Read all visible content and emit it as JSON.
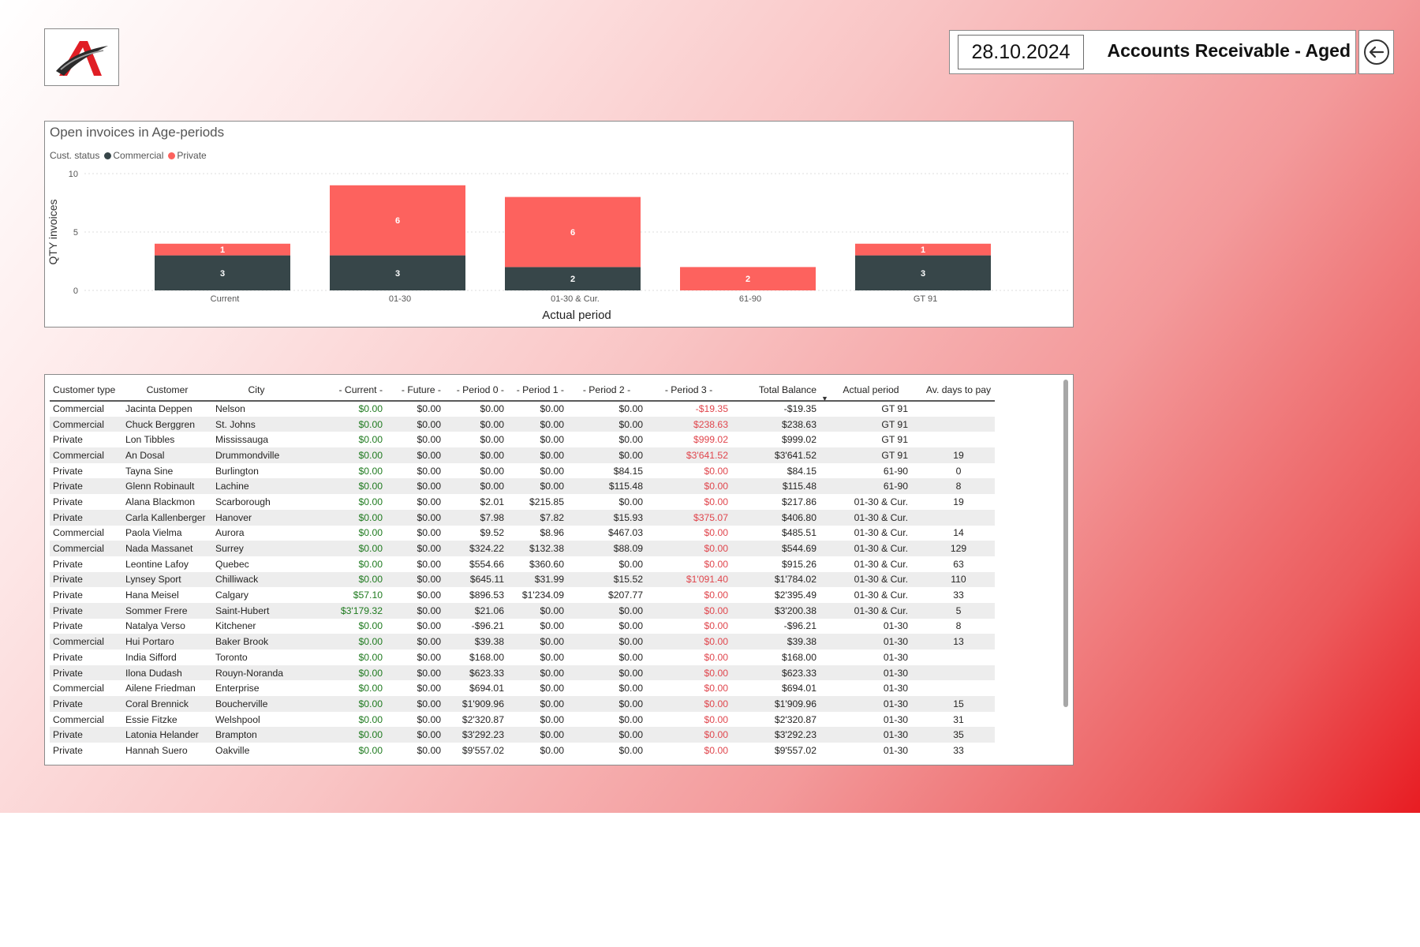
{
  "header": {
    "date": "28.10.2024",
    "title": "Accounts Receivable - Aged",
    "back_icon": "arrow-left-circle-icon"
  },
  "logo": {
    "icon": "company-logo"
  },
  "chart": {
    "title": "Open invoices in Age-periods",
    "legend_label": "Cust. status",
    "legend": [
      {
        "name": "Commercial",
        "color": "#374649"
      },
      {
        "name": "Private",
        "color": "#fd625e"
      }
    ]
  },
  "chart_data": {
    "type": "bar",
    "stacked": true,
    "categories": [
      "Current",
      "01-30",
      "01-30 & Cur.",
      "61-90",
      "GT 91"
    ],
    "series": [
      {
        "name": "Commercial",
        "color": "#374649",
        "values": [
          3,
          3,
          2,
          0,
          3
        ]
      },
      {
        "name": "Private",
        "color": "#fd625e",
        "values": [
          1,
          6,
          6,
          2,
          1
        ]
      }
    ],
    "xlabel": "Actual period",
    "ylabel": "QTY invoices",
    "ylim": [
      0,
      10
    ],
    "yticks": [
      0,
      5,
      10
    ],
    "grid": true,
    "legend_position": "top-left"
  },
  "table": {
    "columns": [
      "Customer type",
      "Customer",
      "City",
      "- Current -",
      "- Future -",
      "- Period 0 -",
      "- Period 1 -",
      "- Period 2 -",
      "- Period 3 -",
      "Total Balance",
      "Actual period",
      "Av. days to pay"
    ],
    "sort_icon": "sort-descending-icon",
    "rows": [
      [
        "Commercial",
        "Jacinta Deppen",
        "Nelson",
        "$0.00",
        "$0.00",
        "$0.00",
        "$0.00",
        "$0.00",
        "-$19.35",
        "-$19.35",
        "GT 91",
        ""
      ],
      [
        "Commercial",
        "Chuck Berggren",
        "St. Johns",
        "$0.00",
        "$0.00",
        "$0.00",
        "$0.00",
        "$0.00",
        "$238.63",
        "$238.63",
        "GT 91",
        ""
      ],
      [
        "Private",
        "Lon Tibbles",
        "Mississauga",
        "$0.00",
        "$0.00",
        "$0.00",
        "$0.00",
        "$0.00",
        "$999.02",
        "$999.02",
        "GT 91",
        ""
      ],
      [
        "Commercial",
        "An Dosal",
        "Drummondville",
        "$0.00",
        "$0.00",
        "$0.00",
        "$0.00",
        "$0.00",
        "$3'641.52",
        "$3'641.52",
        "GT 91",
        "19"
      ],
      [
        "Private",
        "Tayna Sine",
        "Burlington",
        "$0.00",
        "$0.00",
        "$0.00",
        "$0.00",
        "$84.15",
        "$0.00",
        "$84.15",
        "61-90",
        "0"
      ],
      [
        "Private",
        "Glenn Robinault",
        "Lachine",
        "$0.00",
        "$0.00",
        "$0.00",
        "$0.00",
        "$115.48",
        "$0.00",
        "$115.48",
        "61-90",
        "8"
      ],
      [
        "Private",
        "Alana Blackmon",
        "Scarborough",
        "$0.00",
        "$0.00",
        "$2.01",
        "$215.85",
        "$0.00",
        "$0.00",
        "$217.86",
        "01-30 & Cur.",
        "19"
      ],
      [
        "Private",
        "Carla Kallenberger",
        "Hanover",
        "$0.00",
        "$0.00",
        "$7.98",
        "$7.82",
        "$15.93",
        "$375.07",
        "$406.80",
        "01-30 & Cur.",
        ""
      ],
      [
        "Commercial",
        "Paola Vielma",
        "Aurora",
        "$0.00",
        "$0.00",
        "$9.52",
        "$8.96",
        "$467.03",
        "$0.00",
        "$485.51",
        "01-30 & Cur.",
        "14"
      ],
      [
        "Commercial",
        "Nada Massanet",
        "Surrey",
        "$0.00",
        "$0.00",
        "$324.22",
        "$132.38",
        "$88.09",
        "$0.00",
        "$544.69",
        "01-30 & Cur.",
        "129"
      ],
      [
        "Private",
        "Leontine Lafoy",
        "Quebec",
        "$0.00",
        "$0.00",
        "$554.66",
        "$360.60",
        "$0.00",
        "$0.00",
        "$915.26",
        "01-30 & Cur.",
        "63"
      ],
      [
        "Private",
        "Lynsey Sport",
        "Chilliwack",
        "$0.00",
        "$0.00",
        "$645.11",
        "$31.99",
        "$15.52",
        "$1'091.40",
        "$1'784.02",
        "01-30 & Cur.",
        "110"
      ],
      [
        "Private",
        "Hana Meisel",
        "Calgary",
        "$57.10",
        "$0.00",
        "$896.53",
        "$1'234.09",
        "$207.77",
        "$0.00",
        "$2'395.49",
        "01-30 & Cur.",
        "33"
      ],
      [
        "Private",
        "Sommer Frere",
        "Saint-Hubert",
        "$3'179.32",
        "$0.00",
        "$21.06",
        "$0.00",
        "$0.00",
        "$0.00",
        "$3'200.38",
        "01-30 & Cur.",
        "5"
      ],
      [
        "Private",
        "Natalya Verso",
        "Kitchener",
        "$0.00",
        "$0.00",
        "-$96.21",
        "$0.00",
        "$0.00",
        "$0.00",
        "-$96.21",
        "01-30",
        "8"
      ],
      [
        "Commercial",
        "Hui Portaro",
        "Baker Brook",
        "$0.00",
        "$0.00",
        "$39.38",
        "$0.00",
        "$0.00",
        "$0.00",
        "$39.38",
        "01-30",
        "13"
      ],
      [
        "Private",
        "India Sifford",
        "Toronto",
        "$0.00",
        "$0.00",
        "$168.00",
        "$0.00",
        "$0.00",
        "$0.00",
        "$168.00",
        "01-30",
        ""
      ],
      [
        "Private",
        "Ilona Dudash",
        "Rouyn-Noranda",
        "$0.00",
        "$0.00",
        "$623.33",
        "$0.00",
        "$0.00",
        "$0.00",
        "$623.33",
        "01-30",
        ""
      ],
      [
        "Commercial",
        "Ailene Friedman",
        "Enterprise",
        "$0.00",
        "$0.00",
        "$694.01",
        "$0.00",
        "$0.00",
        "$0.00",
        "$694.01",
        "01-30",
        ""
      ],
      [
        "Private",
        "Coral Brennick",
        "Boucherville",
        "$0.00",
        "$0.00",
        "$1'909.96",
        "$0.00",
        "$0.00",
        "$0.00",
        "$1'909.96",
        "01-30",
        "15"
      ],
      [
        "Commercial",
        "Essie Fitzke",
        "Welshpool",
        "$0.00",
        "$0.00",
        "$2'320.87",
        "$0.00",
        "$0.00",
        "$0.00",
        "$2'320.87",
        "01-30",
        "31"
      ],
      [
        "Private",
        "Latonia Helander",
        "Brampton",
        "$0.00",
        "$0.00",
        "$3'292.23",
        "$0.00",
        "$0.00",
        "$0.00",
        "$3'292.23",
        "01-30",
        "35"
      ],
      [
        "Private",
        "Hannah Suero",
        "Oakville",
        "$0.00",
        "$0.00",
        "$9'557.02",
        "$0.00",
        "$0.00",
        "$0.00",
        "$9'557.02",
        "01-30",
        "33"
      ]
    ]
  }
}
